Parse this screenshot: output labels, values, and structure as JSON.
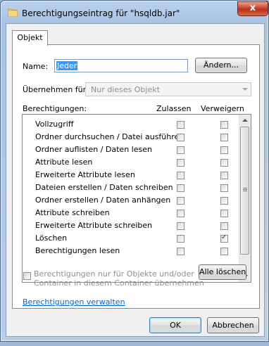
{
  "window": {
    "title": "Berechtigungseintrag für \"hsqldb.jar\"",
    "close_label": "x"
  },
  "tabs": [
    {
      "label": "Objekt"
    }
  ],
  "name_field": {
    "label": "Name:",
    "value": "Jeder"
  },
  "change_button": "Ändern...",
  "apply_to": {
    "label": "Übernehmen für:",
    "value": "Nur dieses Objekt"
  },
  "permissions": {
    "label": "Berechtigungen:",
    "col_allow": "Zulassen",
    "col_deny": "Verweigern",
    "items": [
      {
        "name": "Vollzugriff",
        "allow": false,
        "deny": false
      },
      {
        "name": "Ordner durchsuchen / Datei ausführen",
        "allow": false,
        "deny": false
      },
      {
        "name": "Ordner auflisten / Daten lesen",
        "allow": false,
        "deny": false
      },
      {
        "name": "Attribute lesen",
        "allow": false,
        "deny": false
      },
      {
        "name": "Erweiterte Attribute lesen",
        "allow": false,
        "deny": false
      },
      {
        "name": "Dateien erstellen / Daten schreiben",
        "allow": false,
        "deny": false
      },
      {
        "name": "Ordner erstellen / Daten anhängen",
        "allow": false,
        "deny": false
      },
      {
        "name": "Attribute schreiben",
        "allow": false,
        "deny": false
      },
      {
        "name": "Erweiterte Attribute schreiben",
        "allow": false,
        "deny": false
      },
      {
        "name": "Löschen",
        "allow": false,
        "deny": true
      },
      {
        "name": "Berechtigungen lesen",
        "allow": false,
        "deny": false
      }
    ]
  },
  "inherit_checkbox": {
    "line1": "Berechtigungen nur für Objekte und/oder",
    "line2": "Container in diesem Container übernehmen",
    "checked": false
  },
  "clear_all_button": "Alle löschen",
  "manage_link": "Berechtigungen verwalten",
  "ok_button": "OK",
  "cancel_button": "Abbrechen"
}
